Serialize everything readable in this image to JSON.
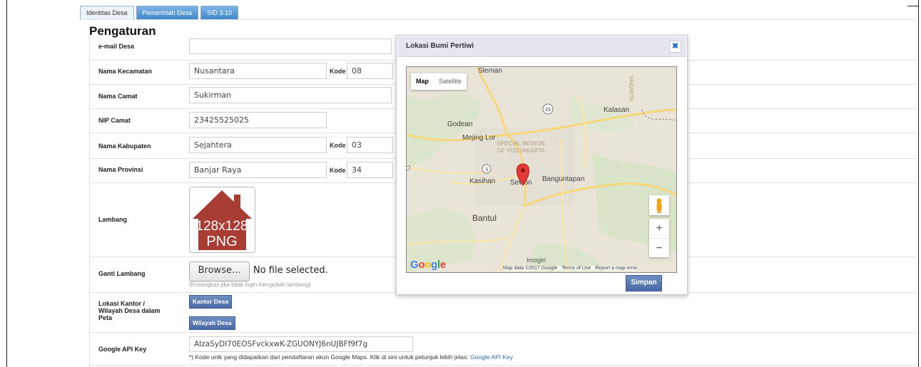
{
  "tabs": [
    {
      "label": "Identitas Desa",
      "active": true
    },
    {
      "label": "Pemerintah Desa",
      "active": false
    },
    {
      "label": "SID 3.10",
      "active": false
    }
  ],
  "page_title": "Pengaturan",
  "form": {
    "email_label": "e-mail Desa",
    "email_value": "",
    "kecamatan_label": "Nama Kecamatan",
    "kecamatan_value": "Nusantara",
    "kecamatan_kode_label": "Kode",
    "kecamatan_kode_value": "08",
    "camat_label": "Nama Camat",
    "camat_value": "Sukirman",
    "nip_label": "NIP Camat",
    "nip_value": "23425525025",
    "kabupaten_label": "Nama Kabupaten",
    "kabupaten_value": "Sejahtera",
    "kabupaten_kode_label": "Kode",
    "kabupaten_kode_value": "03",
    "provinsi_label": "Nama Provinsi",
    "provinsi_value": "Banjar Raya",
    "provinsi_kode_label": "Kode",
    "provinsi_kode_value": "34",
    "lambang_label": "Lambang",
    "lambang_placeholder_line1": "128x128",
    "lambang_placeholder_line2": "PNG",
    "ganti_label": "Ganti Lambang",
    "browse_label": "Browse...",
    "no_file": "No file selected.",
    "ganti_hint": "(Kosongkan jika tidak ingin mengubah lambang)",
    "lokasi_label": "Lokasi Kantor / Wilayah Desa dalam Peta",
    "kantor_button": "Kantor Desa",
    "wilayah_button": "Wilayah Desa",
    "api_label": "Google API Key",
    "api_value": "AIzaSyDI70EOSFvckxwK-ZGUONYJ6nUJBFf9f7g",
    "api_note": "*) Kode unik yang didapatkan dari pendaftaran akun Google Maps. Klik di sini untuk petunjuk lebih jelas:",
    "api_link": "Google API Key"
  },
  "modal": {
    "title": "Lokasi Bumi Pertiwi",
    "close_icon": "close-icon",
    "map_type_map": "Map",
    "map_type_satellite": "Satellite",
    "zoom_in": "+",
    "zoom_out": "−",
    "google_logo": "Google",
    "attribution_data": "Map data ©2017 Google",
    "attribution_terms": "Terms of Use",
    "attribution_report": "Report a map error",
    "save_button": "Simpan",
    "places": {
      "sleman": "Sleman",
      "godean": "Godean",
      "mejing": "Mejing Lor",
      "special1": "SPECIAL REGION",
      "special2": "OF YOGYAKARTA",
      "kalasan": "Kalasan",
      "kasihan": "Kasihan",
      "sewon": "Sewon",
      "banguntapan": "Banguntapan",
      "bantul": "Bantul",
      "imogiri": "Imogiri",
      "yakarta": "YAKARTA",
      "road15": "15",
      "road3": "3"
    }
  },
  "colors": {
    "tab_blue": "#3d84c8",
    "button_blue": "#4a6aa5",
    "link": "#2a6fb0",
    "marker": "#e53935"
  }
}
